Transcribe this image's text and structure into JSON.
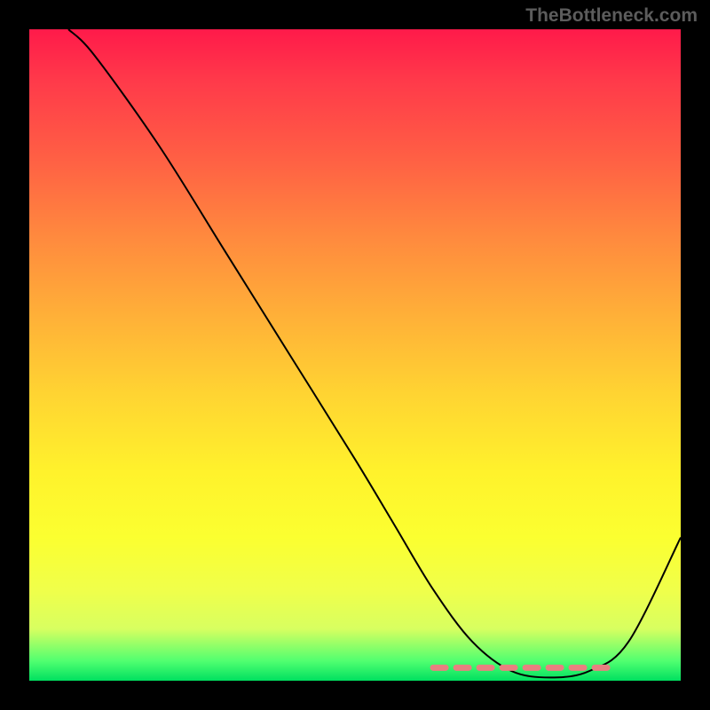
{
  "watermark": "TheBottleneck.com",
  "chart_data": {
    "type": "line",
    "title": "",
    "xlabel": "",
    "ylabel": "",
    "xlim": [
      0,
      100
    ],
    "ylim": [
      0,
      100
    ],
    "series": [
      {
        "name": "curve",
        "x": [
          6,
          10,
          20,
          30,
          40,
          50,
          56,
          62,
          68,
          74,
          80,
          86,
          92,
          100
        ],
        "y": [
          100,
          96,
          82,
          66,
          50,
          34,
          24,
          14,
          6,
          1.5,
          0.5,
          1.5,
          6,
          22
        ]
      }
    ],
    "flat_region": {
      "x_start": 62,
      "x_end": 90,
      "y": 2
    },
    "background": "rainbow-gradient-vertical"
  }
}
